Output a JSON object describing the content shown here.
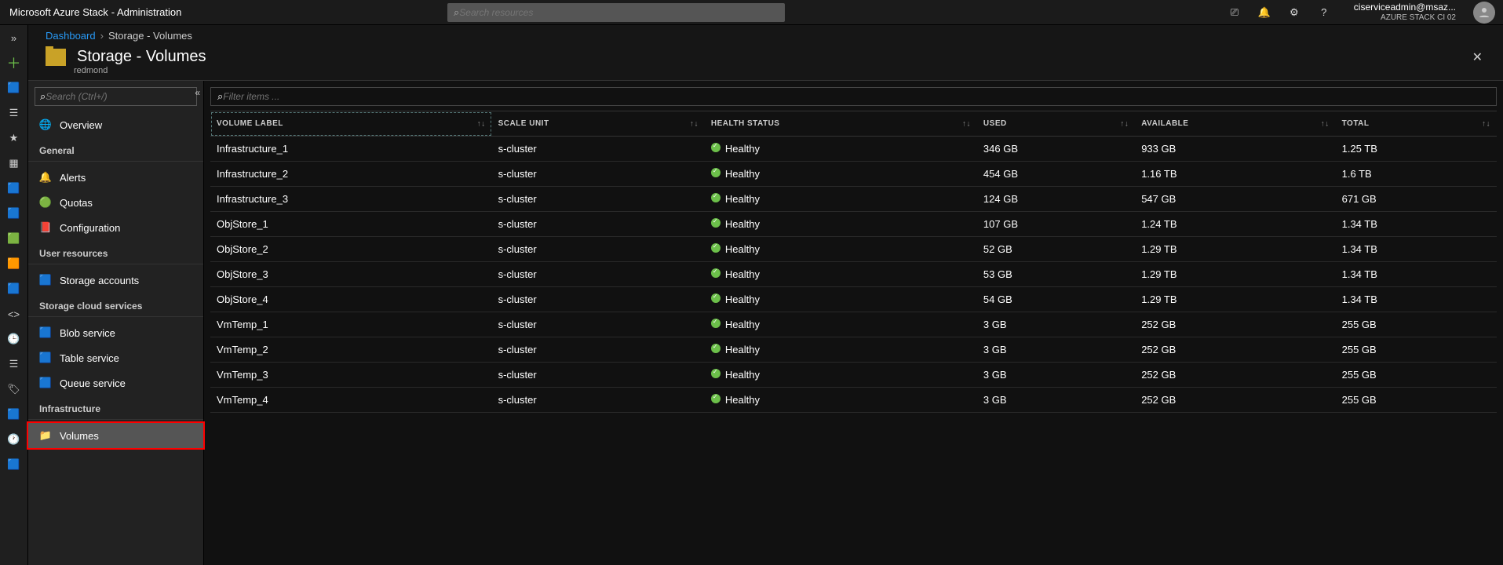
{
  "header": {
    "brand_prefix": "Microsoft Azure Stack",
    "brand_suffix": "- Administration",
    "search_placeholder": "Search resources",
    "user_email": "ciserviceadmin@msaz...",
    "tenant": "AZURE STACK CI 02"
  },
  "breadcrumb": {
    "root": "Dashboard",
    "current": "Storage - Volumes"
  },
  "blade": {
    "title": "Storage - Volumes",
    "subtitle": "redmond"
  },
  "sidebar": {
    "search_placeholder": "Search (Ctrl+/)",
    "sections": [
      {
        "heading": null,
        "items": [
          {
            "label": "Overview",
            "icon": "🌐"
          }
        ]
      },
      {
        "heading": "General",
        "items": [
          {
            "label": "Alerts",
            "icon": "🔔"
          },
          {
            "label": "Quotas",
            "icon": "🟢"
          },
          {
            "label": "Configuration",
            "icon": "📕"
          }
        ]
      },
      {
        "heading": "User resources",
        "items": [
          {
            "label": "Storage accounts",
            "icon": "🟦"
          }
        ]
      },
      {
        "heading": "Storage cloud services",
        "items": [
          {
            "label": "Blob service",
            "icon": "🟦"
          },
          {
            "label": "Table service",
            "icon": "🟦"
          },
          {
            "label": "Queue service",
            "icon": "🟦"
          }
        ]
      },
      {
        "heading": "Infrastructure",
        "items": [
          {
            "label": "Volumes",
            "icon": "📁",
            "highlight": true
          }
        ]
      }
    ]
  },
  "table": {
    "filter_placeholder": "Filter items ...",
    "columns": [
      "VOLUME LABEL",
      "SCALE UNIT",
      "HEALTH STATUS",
      "USED",
      "AVAILABLE",
      "TOTAL"
    ],
    "rows": [
      {
        "label": "Infrastructure_1",
        "scale": "s-cluster",
        "health": "Healthy",
        "used": "346 GB",
        "avail": "933 GB",
        "total": "1.25 TB"
      },
      {
        "label": "Infrastructure_2",
        "scale": "s-cluster",
        "health": "Healthy",
        "used": "454 GB",
        "avail": "1.16 TB",
        "total": "1.6 TB"
      },
      {
        "label": "Infrastructure_3",
        "scale": "s-cluster",
        "health": "Healthy",
        "used": "124 GB",
        "avail": "547 GB",
        "total": "671 GB"
      },
      {
        "label": "ObjStore_1",
        "scale": "s-cluster",
        "health": "Healthy",
        "used": "107 GB",
        "avail": "1.24 TB",
        "total": "1.34 TB"
      },
      {
        "label": "ObjStore_2",
        "scale": "s-cluster",
        "health": "Healthy",
        "used": "52 GB",
        "avail": "1.29 TB",
        "total": "1.34 TB"
      },
      {
        "label": "ObjStore_3",
        "scale": "s-cluster",
        "health": "Healthy",
        "used": "53 GB",
        "avail": "1.29 TB",
        "total": "1.34 TB"
      },
      {
        "label": "ObjStore_4",
        "scale": "s-cluster",
        "health": "Healthy",
        "used": "54 GB",
        "avail": "1.29 TB",
        "total": "1.34 TB"
      },
      {
        "label": "VmTemp_1",
        "scale": "s-cluster",
        "health": "Healthy",
        "used": "3 GB",
        "avail": "252 GB",
        "total": "255 GB"
      },
      {
        "label": "VmTemp_2",
        "scale": "s-cluster",
        "health": "Healthy",
        "used": "3 GB",
        "avail": "252 GB",
        "total": "255 GB"
      },
      {
        "label": "VmTemp_3",
        "scale": "s-cluster",
        "health": "Healthy",
        "used": "3 GB",
        "avail": "252 GB",
        "total": "255 GB"
      },
      {
        "label": "VmTemp_4",
        "scale": "s-cluster",
        "health": "Healthy",
        "used": "3 GB",
        "avail": "252 GB",
        "total": "255 GB"
      }
    ]
  },
  "iconrail": [
    "»",
    "＋",
    "🟦",
    "☰",
    "★",
    "▦",
    "🟦",
    "🟦",
    "🟩",
    "🟧",
    "🟦",
    "<>",
    "🕒",
    "☰",
    "🏷",
    "🟦",
    "🕐",
    "🟦"
  ]
}
